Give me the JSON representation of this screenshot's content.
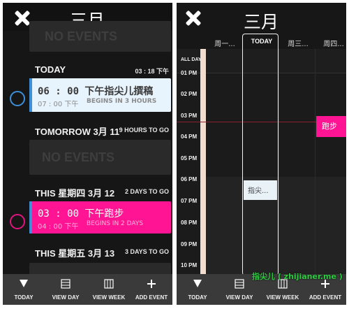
{
  "left": {
    "title": "三月",
    "no_events_top": "NO EVENTS",
    "today": {
      "label": "TODAY",
      "time": "03 : 18 下午",
      "event": {
        "title": "06 : 00 下午指尖儿撰稿",
        "sub_time": "07 : 00 下午",
        "sub_note": "BEGINS IN 3 HOURS",
        "color": "#e8f4fd",
        "bar_color": "#3d8fd8"
      }
    },
    "tomorrow": {
      "label": "TOMORROW 3月 11",
      "note": "9 HOURS TO GO",
      "no_events": "NO EVENTS"
    },
    "thursday": {
      "label": "THIS 星期四 3月 12",
      "note": "2 DAYS TO GO",
      "event": {
        "title": "03 : 00 下午跑步",
        "sub_time": "04 : 00 下午",
        "sub_note": "BEGINS IN 2 DAYS",
        "color": "#ff1493",
        "bar_color": "#3d8fd8"
      }
    },
    "friday": {
      "label": "THIS 星期五 3月 13",
      "note": "3 DAYS TO GO"
    },
    "tabs": [
      {
        "icon": "arrow-down-icon",
        "label": "TODAY"
      },
      {
        "icon": "view-day-icon",
        "label": "VIEW DAY"
      },
      {
        "icon": "view-week-icon",
        "label": "VIEW WEEK"
      },
      {
        "icon": "plus-icon",
        "label": "ADD EVENT"
      }
    ]
  },
  "right": {
    "title": "三月",
    "columns": [
      "周一...",
      "TODAY",
      "周三...",
      "周四..."
    ],
    "allday": "ALL DAY",
    "hours": [
      "01 PM",
      "02 PM",
      "03 PM",
      "04 PM",
      "05 PM",
      "06 PM",
      "07 PM",
      "08 PM",
      "09 PM",
      "10 PM"
    ],
    "events": [
      {
        "title": "指尖...",
        "color": "#e8f2f7"
      },
      {
        "title": "跑步",
        "color": "#ff1493"
      }
    ],
    "tabs": [
      {
        "icon": "arrow-down-icon",
        "label": "TODAY"
      },
      {
        "icon": "view-day-icon",
        "label": "VIEW DAY"
      },
      {
        "icon": "view-week-icon",
        "label": "VIEW WEEK"
      },
      {
        "icon": "plus-icon",
        "label": "ADD EVENT"
      }
    ],
    "watermark": "指尖儿 ( zhijianer.me )"
  }
}
